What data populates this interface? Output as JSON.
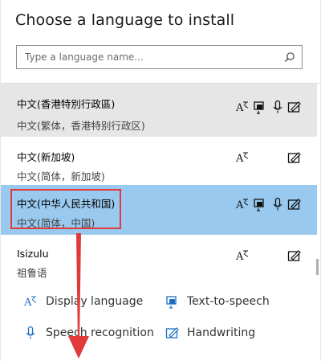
{
  "dialog": {
    "title": "Choose a language to install",
    "search": {
      "placeholder": "Type a language name..."
    }
  },
  "languages": [
    {
      "name": "中文(香港特別行政區)",
      "sub": "中文(繁体，香港特别行政区)",
      "features": [
        "display-language",
        "text-to-speech",
        "speech-recognition",
        "handwriting"
      ],
      "state": "hover"
    },
    {
      "name": "中文(新加坡)",
      "sub": "中文(简体，新加坡)",
      "features": [
        "display-language",
        "handwriting"
      ],
      "state": "normal"
    },
    {
      "name": "中文(中华人民共和国)",
      "sub": "中文(简体，中国)",
      "features": [
        "display-language",
        "text-to-speech",
        "speech-recognition",
        "handwriting"
      ],
      "state": "selected"
    },
    {
      "name": "Isizulu",
      "sub": "祖鲁语",
      "features": [
        "display-language",
        "handwriting"
      ],
      "state": "normal"
    }
  ],
  "legend": {
    "display_language": "Display language",
    "text_to_speech": "Text-to-speech",
    "speech_recognition": "Speech recognition",
    "handwriting": "Handwriting"
  },
  "colors": {
    "hover_row": "#e6e6e6",
    "selected_row": "#99c9ef",
    "highlight_box": "#e03a3a",
    "accent_icon": "#1e6fc2",
    "annotation_arrow": "#e03a3a"
  }
}
